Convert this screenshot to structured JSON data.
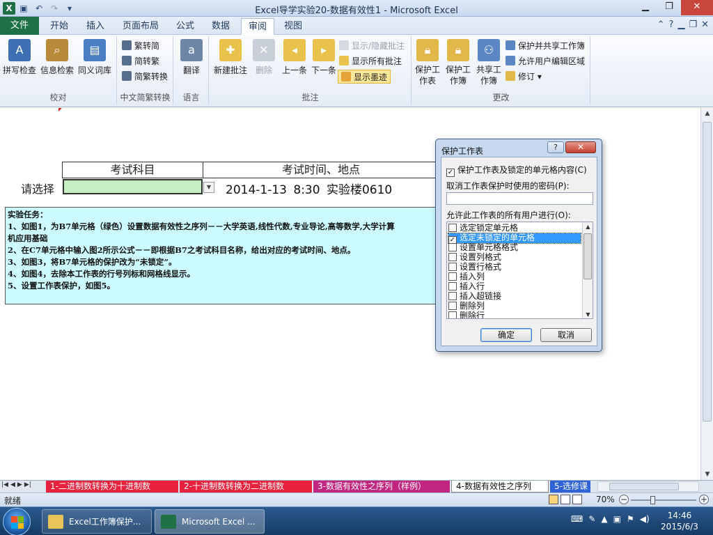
{
  "window": {
    "title": "Excel导学实验20-数据有效性1  -  Microsoft Excel",
    "app_icon": "X",
    "minimize": "▁",
    "restore": "❐",
    "close": "✕"
  },
  "ribbon_tabs": [
    {
      "label": "文件"
    },
    {
      "label": "开始"
    },
    {
      "label": "插入"
    },
    {
      "label": "页面布局"
    },
    {
      "label": "公式"
    },
    {
      "label": "数据"
    },
    {
      "label": "审阅"
    },
    {
      "label": "视图"
    }
  ],
  "ribbon": {
    "groups": {
      "proofing": {
        "label": "校对",
        "buttons": [
          "拼写检查",
          "信息检索",
          "同义词库"
        ]
      },
      "chinese": {
        "label": "中文简繁转换",
        "buttons": [
          "繁转简",
          "简转繁",
          "简繁转换"
        ]
      },
      "language": {
        "label": "语言",
        "buttons": [
          "翻译"
        ]
      },
      "comments": {
        "label": "批注",
        "buttons": [
          "新建批注",
          "删除",
          "上一条",
          "下一条"
        ],
        "small_buttons": [
          "显示/隐藏批注",
          "显示所有批注",
          "显示墨迹"
        ]
      },
      "changes": {
        "label": "更改",
        "buttons": [
          "保护工作表",
          "保护工作簿",
          "共享工作簿"
        ],
        "small_buttons": [
          "保护并共享工作簿",
          "允许用户编辑区域",
          "修订"
        ]
      }
    }
  },
  "sheet": {
    "header_subject": "考试科目",
    "header_time": "考试时间、地点",
    "select_label": "请选择",
    "time_value": "2014-1-13  8:30  实验楼0610",
    "task_lines": [
      "实验任务：",
      "1、如图1，为B7单元格（绿色）设置数据有效性之序列－－大学英语,线性代数,专业导论,高等数学,大学计算",
      "机应用基础",
      "2、在C7单元格中输入图2所示公式－－即根据B7之考试科目名称，给出对应的考试时间、地点。",
      "3、如图3，将B7单元格的保护改为“未锁定”。",
      "4、如图4，去除本工作表的行号列标和网格线显示。",
      "5、设置工作表保护，如图5。"
    ]
  },
  "dialog": {
    "title": "保护工作表",
    "help": "?",
    "close": "✕",
    "protect_label": "保护工作表及锁定的单元格内容(C)",
    "protect_checked": true,
    "password_label": "取消工作表保护时使用的密码(P):",
    "password_value": "",
    "allow_label": "允许此工作表的所有用户进行(O):",
    "options": [
      {
        "label": "选定锁定单元格",
        "checked": false,
        "selected": false
      },
      {
        "label": "选定未锁定的单元格",
        "checked": true,
        "selected": true
      },
      {
        "label": "设置单元格格式",
        "checked": false,
        "selected": false
      },
      {
        "label": "设置列格式",
        "checked": false,
        "selected": false
      },
      {
        "label": "设置行格式",
        "checked": false,
        "selected": false
      },
      {
        "label": "插入列",
        "checked": false,
        "selected": false
      },
      {
        "label": "插入行",
        "checked": false,
        "selected": false
      },
      {
        "label": "插入超链接",
        "checked": false,
        "selected": false
      },
      {
        "label": "删除列",
        "checked": false,
        "selected": false
      },
      {
        "label": "删除行",
        "checked": false,
        "selected": false
      }
    ],
    "ok": "确定",
    "cancel": "取消"
  },
  "sheet_tabs": [
    {
      "label": "1-二进制数转换为十进制数"
    },
    {
      "label": "2-十进制数转换为二进制数"
    },
    {
      "label": "3-数据有效性之序列（样例）"
    },
    {
      "label": "4-数据有效性之序列"
    },
    {
      "label": "5-选修课"
    }
  ],
  "status": {
    "text": "就绪",
    "zoom": "70%"
  },
  "taskbar": {
    "items": [
      {
        "label": "Excel工作簿保护..."
      },
      {
        "label": "Microsoft Excel ..."
      }
    ],
    "time": "14:46",
    "date": "2015/6/3"
  },
  "colors": {
    "excel_green": "#1e7145",
    "input_cell": "#c6f0c4",
    "task_box": "#ccfcff",
    "selection": "#3399ff"
  }
}
